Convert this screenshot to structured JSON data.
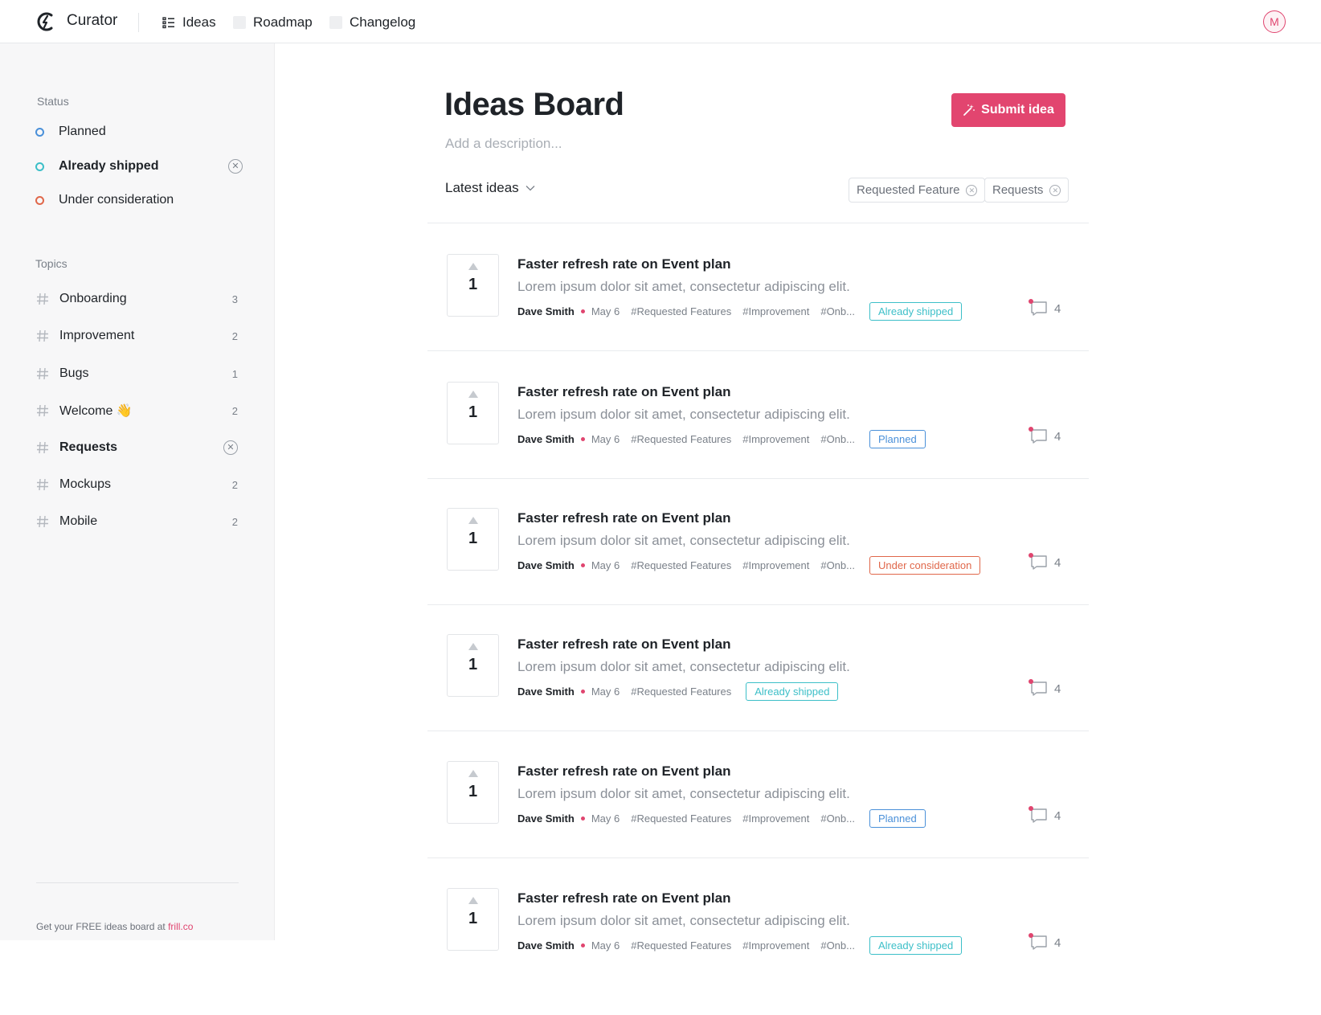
{
  "app": {
    "brand": "Curator",
    "accent": "#e2456f",
    "avatar_initial": "M"
  },
  "nav": {
    "items": [
      {
        "label": "Ideas",
        "icon": "list-icon"
      },
      {
        "label": "Roadmap",
        "icon": "placeholder-icon"
      },
      {
        "label": "Changelog",
        "icon": "placeholder-icon"
      }
    ]
  },
  "sidebar": {
    "status_heading": "Status",
    "statuses": [
      {
        "label": "Planned",
        "color": "#4a90d9",
        "active": false
      },
      {
        "label": "Already shipped",
        "color": "#3cbfc8",
        "active": true
      },
      {
        "label": "Under consideration",
        "color": "#e0674a",
        "active": false
      }
    ],
    "topics_heading": "Topics",
    "topics": [
      {
        "label": "Onboarding",
        "count": "3",
        "active": false
      },
      {
        "label": "Improvement",
        "count": "2",
        "active": false
      },
      {
        "label": "Bugs",
        "count": "1",
        "active": false
      },
      {
        "label": "Welcome 👋",
        "count": "2",
        "active": false
      },
      {
        "label": "Requests",
        "count": "",
        "active": true
      },
      {
        "label": "Mockups",
        "count": "2",
        "active": false
      },
      {
        "label": "Mobile",
        "count": "2",
        "active": false
      }
    ],
    "footer_text": "Get your FREE ideas board at ",
    "footer_link": "frill.co"
  },
  "main": {
    "title": "Ideas Board",
    "description_placeholder": "Add a description...",
    "submit_label": "Submit idea",
    "sort_label": "Latest ideas",
    "filters": [
      "Requested Feature",
      "Requests"
    ]
  },
  "status_colors": {
    "Already shipped": "#3cbfc8",
    "Planned": "#4a90d9",
    "Under consideration": "#e0674a"
  },
  "ideas": [
    {
      "votes": "1",
      "title": "Faster refresh rate on Event plan",
      "body": "Lorem ipsum dolor sit amet, consectetur adipiscing elit.",
      "author": "Dave Smith",
      "date": "May 6",
      "tags": [
        "#Requested Features",
        "#Improvement",
        "#Onb..."
      ],
      "status": "Already shipped",
      "comments": "4"
    },
    {
      "votes": "1",
      "title": "Faster refresh rate on Event plan",
      "body": "Lorem ipsum dolor sit amet, consectetur adipiscing elit.",
      "author": "Dave Smith",
      "date": "May 6",
      "tags": [
        "#Requested Features",
        "#Improvement",
        "#Onb..."
      ],
      "status": "Planned",
      "comments": "4"
    },
    {
      "votes": "1",
      "title": "Faster refresh rate on Event plan",
      "body": "Lorem ipsum dolor sit amet, consectetur adipiscing elit.",
      "author": "Dave Smith",
      "date": "May 6",
      "tags": [
        "#Requested Features",
        "#Improvement",
        "#Onb..."
      ],
      "status": "Under consideration",
      "comments": "4"
    },
    {
      "votes": "1",
      "title": "Faster refresh rate on Event plan",
      "body": "Lorem ipsum dolor sit amet, consectetur adipiscing elit.",
      "author": "Dave Smith",
      "date": "May 6",
      "tags": [
        "#Requested Features"
      ],
      "status": "Already shipped",
      "comments": "4"
    },
    {
      "votes": "1",
      "title": "Faster refresh rate on Event plan",
      "body": "Lorem ipsum dolor sit amet, consectetur adipiscing elit.",
      "author": "Dave Smith",
      "date": "May 6",
      "tags": [
        "#Requested Features",
        "#Improvement",
        "#Onb..."
      ],
      "status": "Planned",
      "comments": "4"
    },
    {
      "votes": "1",
      "title": "Faster refresh rate on Event plan",
      "body": "Lorem ipsum dolor sit amet, consectetur adipiscing elit.",
      "author": "Dave Smith",
      "date": "May 6",
      "tags": [
        "#Requested Features",
        "#Improvement",
        "#Onb..."
      ],
      "status": "Already shipped",
      "comments": "4"
    }
  ]
}
